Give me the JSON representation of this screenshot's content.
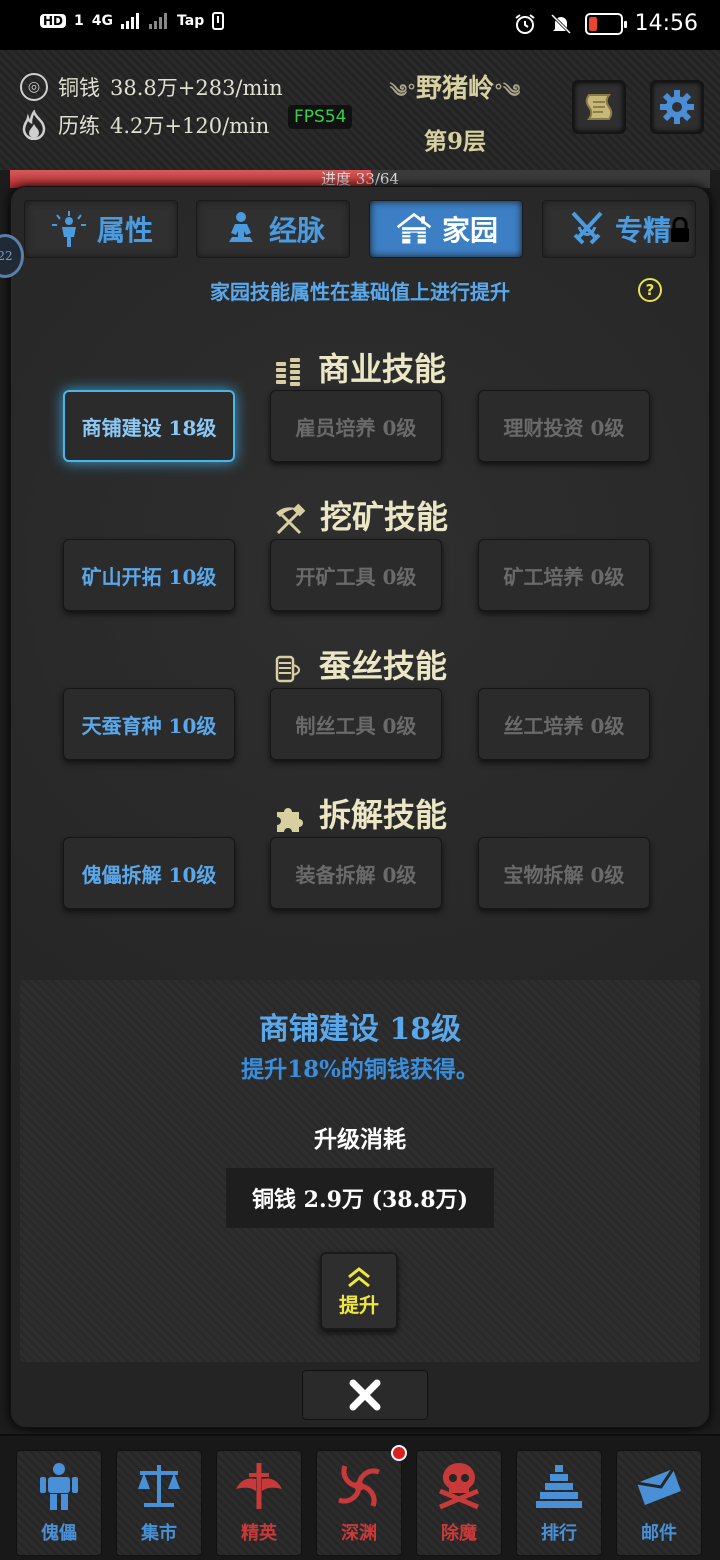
{
  "status_bar": {
    "left_indicators": [
      "HD",
      "1",
      "4G",
      "Tap"
    ],
    "time": "14:56"
  },
  "header": {
    "coins_label": "铜钱",
    "coins_value": "38.8万+283/min",
    "exp_label": "历练",
    "exp_value": "4.2万+120/min",
    "fps": "FPS54",
    "location": "野猪岭",
    "floor": "第9层"
  },
  "progress": {
    "text": "进度 33/64",
    "fraction": 0.516
  },
  "side_badge": "22",
  "tabs": [
    {
      "label": "属性",
      "icon": "person-aura-icon"
    },
    {
      "label": "经脉",
      "icon": "meditation-icon"
    },
    {
      "label": "家园",
      "icon": "house-icon",
      "active": true
    },
    {
      "label": "专精",
      "icon": "crossed-swords-icon",
      "locked": true
    }
  ],
  "description": "家园技能属性在基础值上进行提升",
  "sections": [
    {
      "title": "商业技能",
      "icon": "coin-stack-icon",
      "skills": [
        {
          "name": "商铺建设",
          "level": "18级"
        },
        {
          "name": "雇员培养",
          "level": "0级"
        },
        {
          "name": "理财投资",
          "level": "0级"
        }
      ]
    },
    {
      "title": "挖矿技能",
      "icon": "pickaxe-hammer-icon",
      "skills": [
        {
          "name": "矿山开拓",
          "level": "10级"
        },
        {
          "name": "开矿工具",
          "level": "0级"
        },
        {
          "name": "矿工培养",
          "level": "0级"
        }
      ]
    },
    {
      "title": "蚕丝技能",
      "icon": "silk-spool-icon",
      "skills": [
        {
          "name": "天蚕育种",
          "level": "10级"
        },
        {
          "name": "制丝工具",
          "level": "0级"
        },
        {
          "name": "丝工培养",
          "level": "0级"
        }
      ]
    },
    {
      "title": "拆解技能",
      "icon": "puzzle-piece-icon",
      "skills": [
        {
          "name": "傀儡拆解",
          "level": "10级"
        },
        {
          "name": "装备拆解",
          "level": "0级"
        },
        {
          "name": "宝物拆解",
          "level": "0级"
        }
      ]
    }
  ],
  "skill_labels": [
    [
      "商铺建设  18级",
      "雇员培养  0级",
      "理财投资  0级"
    ],
    [
      "矿山开拓  10级",
      "开矿工具  0级",
      "矿工培养  0级"
    ],
    [
      "天蚕育种  10级",
      "制丝工具  0级",
      "丝工培养  0级"
    ],
    [
      "傀儡拆解  10级",
      "装备拆解  0级",
      "宝物拆解  0级"
    ]
  ],
  "detail": {
    "title": "商铺建设  18级",
    "effect": "提升18%的铜钱获得。",
    "cost_label": "升级消耗",
    "cost": "铜钱  2.9万  (38.8万)",
    "upgrade_label": "提升"
  },
  "nav": [
    {
      "label": "傀儡",
      "icon": "puppet-icon",
      "color": "#4a90d6"
    },
    {
      "label": "集市",
      "icon": "scales-icon",
      "color": "#4a90d6"
    },
    {
      "label": "精英",
      "icon": "winged-sword-icon",
      "color": "#c83a3a"
    },
    {
      "label": "深渊",
      "icon": "vortex-icon",
      "color": "#c83a3a",
      "notification": true
    },
    {
      "label": "除魔",
      "icon": "skull-crossbones-icon",
      "color": "#c83a3a"
    },
    {
      "label": "排行",
      "icon": "pyramid-icon",
      "color": "#4a90d6"
    },
    {
      "label": "邮件",
      "icon": "envelope-icon",
      "color": "#4a90d6"
    }
  ],
  "colors": {
    "accent_blue": "#3c7fc4",
    "skill_blue": "#5aa8ea",
    "upgrade_yellow": "#f0e640",
    "danger_red": "#c83a3a"
  }
}
